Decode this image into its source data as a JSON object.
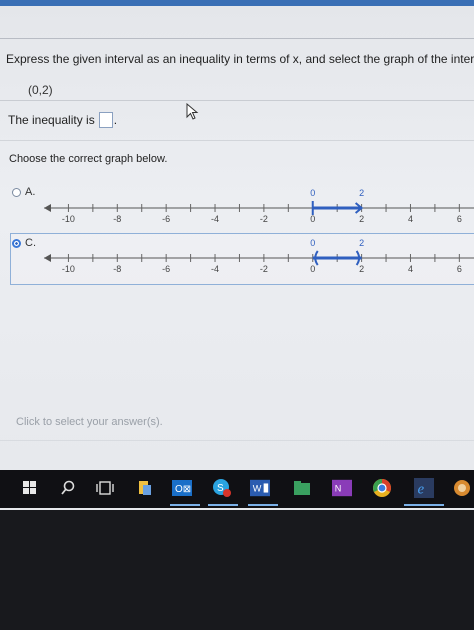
{
  "question": {
    "text": "Express the given interval as an inequality in terms of x, and select the graph of the interval",
    "interval": "(0,2)",
    "inequality_label": "The inequality is",
    "inequality_suffix": ".",
    "choose_label": "Choose the correct graph below."
  },
  "options": [
    {
      "label": "A.",
      "selected": false,
      "ticks": [
        "-10",
        "-8",
        "-6",
        "-4",
        "-2",
        "0",
        "2",
        "4",
        "6"
      ],
      "endpoint_labels": [
        "0",
        "2"
      ]
    },
    {
      "label": "C.",
      "selected": true,
      "ticks": [
        "-10",
        "-8",
        "-6",
        "-4",
        "-2",
        "0",
        "2",
        "4",
        "6"
      ],
      "endpoint_labels": [
        "0",
        "2"
      ]
    }
  ],
  "footer": {
    "hint": "Click to select your answer(s)."
  },
  "taskbar": {
    "icons": [
      "windows-icon",
      "search-icon",
      "task-view-icon",
      "file-explorer-icon",
      "outlook-icon",
      "skype-icon",
      "word-icon",
      "folder-icon",
      "onenote-icon",
      "chrome-icon",
      "edge-icon",
      "app-icon"
    ]
  },
  "colors": {
    "accent": "#3a6fb5",
    "interval_blue": "#2f5fbf",
    "radio_selected": "#2c62c0"
  }
}
